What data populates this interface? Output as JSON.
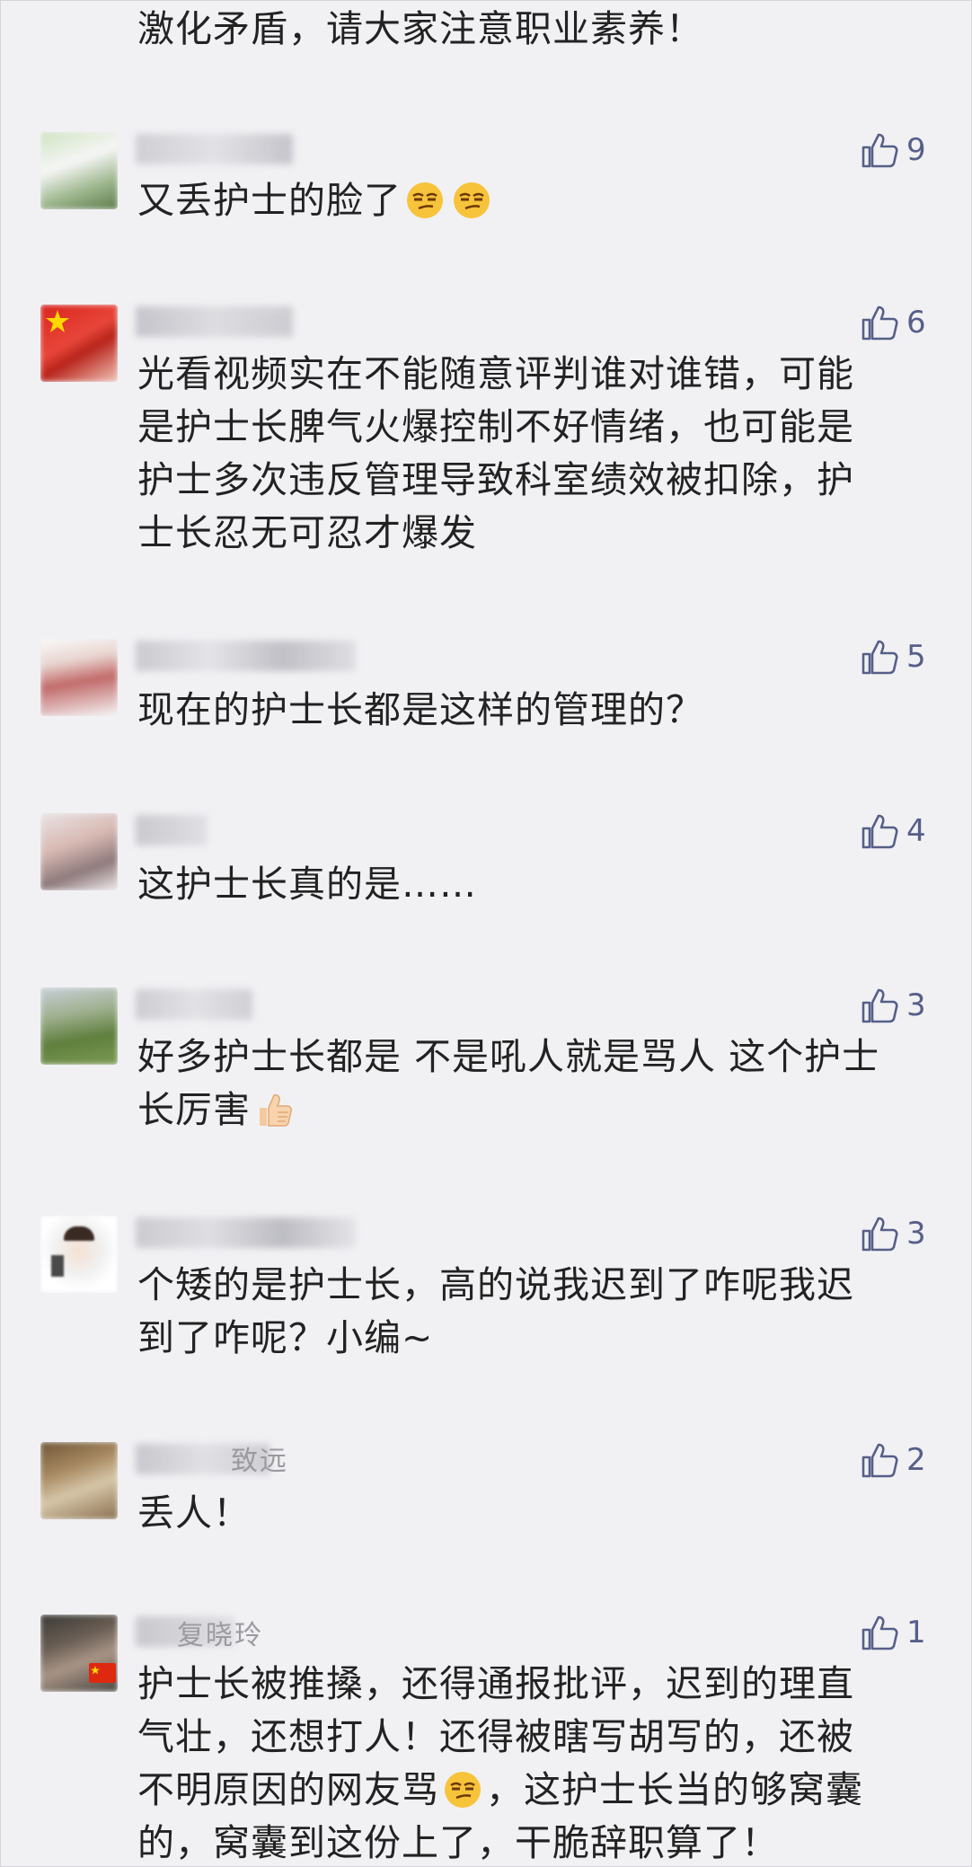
{
  "top_fragment": "激化矛盾，请大家注意职业素养！",
  "comments": [
    {
      "text_lines": [
        "又丢护士的脸了"
      ],
      "emoji_after": 2,
      "likes": "9"
    },
    {
      "text_lines": [
        "光看视频实在不能随意评判谁对谁错，可能",
        "是护士长脾气火爆控制不好情绪，也可能是",
        "护士多次违反管理导致科室绩效被扣除，护",
        "士长忍无可忍才爆发"
      ],
      "likes": "6"
    },
    {
      "text_lines": [
        "现在的护士长都是这样的管理的？"
      ],
      "likes": "5"
    },
    {
      "text_lines": [
        "这护士长真的是……"
      ],
      "likes": "4"
    },
    {
      "text_lines": [
        "好多护士长都是 不是吼人就是骂人 这个护士",
        "长厉害"
      ],
      "likes": "3"
    },
    {
      "text_lines": [
        "个矮的是护士长，高的说我迟到了咋呢我迟",
        "到了咋呢？小编~"
      ],
      "likes": "3"
    },
    {
      "partial_name": "致远",
      "text_lines": [
        "丢人！"
      ],
      "likes": "2"
    },
    {
      "partial_name": "复晓玲",
      "text_lines": [
        "护士长被推搡，还得通报批评，迟到的理直",
        "气壮，还想打人！还得被瞎写胡写的，还被",
        "不明原因的网友骂",
        "，这护士长当的够窝囊",
        "的，窝囊到这份上了，干脆辞职算了！"
      ],
      "likes": "1"
    }
  ],
  "colors": {
    "background": "#f1f1f4",
    "text": "#222222",
    "like_icon": "#565f88",
    "name": "#9a9aa0"
  },
  "icons": [
    "thumbs-up-icon",
    "smirk-emoji-icon",
    "thumbs-up-emoji-icon",
    "china-flag-icon"
  ]
}
